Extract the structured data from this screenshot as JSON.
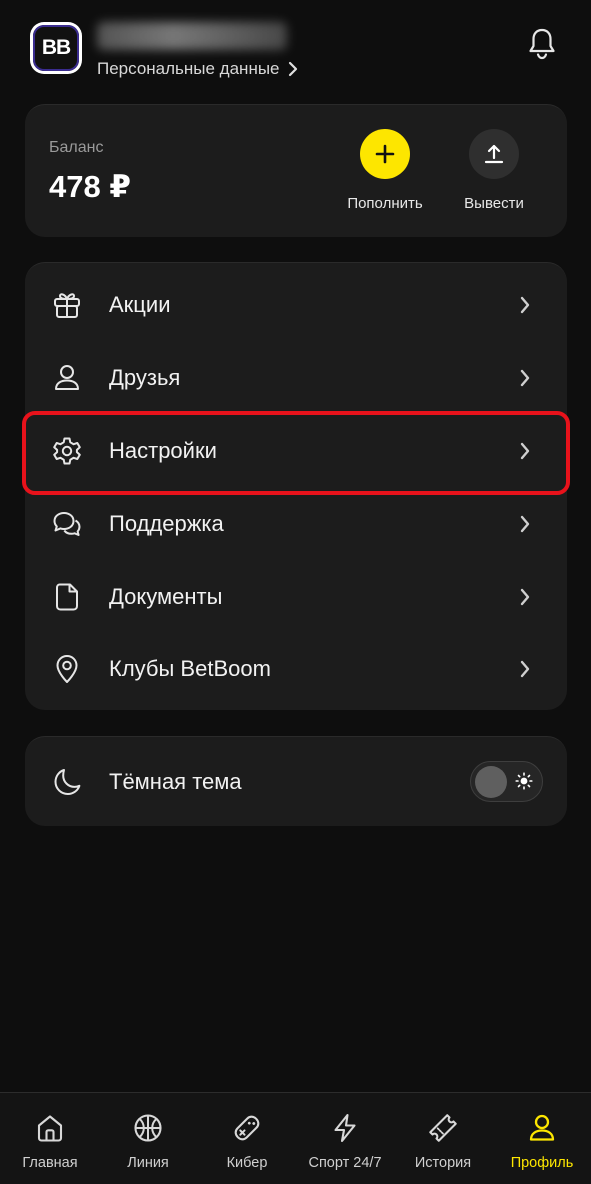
{
  "header": {
    "logo_text": "BB",
    "personal_data_label": "Персональные данные"
  },
  "balance": {
    "label": "Баланс",
    "value": "478 ₽",
    "topup_label": "Пополнить",
    "withdraw_label": "Вывести"
  },
  "menu": {
    "items": [
      {
        "id": "promotions",
        "label": "Акции",
        "icon": "gift-icon"
      },
      {
        "id": "friends",
        "label": "Друзья",
        "icon": "user-icon"
      },
      {
        "id": "settings",
        "label": "Настройки",
        "icon": "gear-icon"
      },
      {
        "id": "support",
        "label": "Поддержка",
        "icon": "chat-bubbles-icon"
      },
      {
        "id": "documents",
        "label": "Документы",
        "icon": "document-icon"
      },
      {
        "id": "clubs",
        "label": "Клубы BetBoom",
        "icon": "location-pin-icon"
      }
    ]
  },
  "theme": {
    "label": "Тёмная тема",
    "dark_mode_enabled": false
  },
  "bottom_nav": {
    "items": [
      {
        "id": "home",
        "label": "Главная",
        "icon": "home-icon",
        "active": false
      },
      {
        "id": "line",
        "label": "Линия",
        "icon": "basketball-icon",
        "active": false
      },
      {
        "id": "cyber",
        "label": "Кибер",
        "icon": "gamepad-icon",
        "active": false
      },
      {
        "id": "sport247",
        "label": "Спорт 24/7",
        "icon": "lightning-icon",
        "active": false
      },
      {
        "id": "history",
        "label": "История",
        "icon": "ticket-icon",
        "active": false
      },
      {
        "id": "profile",
        "label": "Профиль",
        "icon": "profile-icon",
        "active": true
      }
    ]
  },
  "colors": {
    "accent": "#fde600",
    "highlight": "#e8121b",
    "background": "#0e0e0e",
    "card": "#1c1c1c"
  }
}
